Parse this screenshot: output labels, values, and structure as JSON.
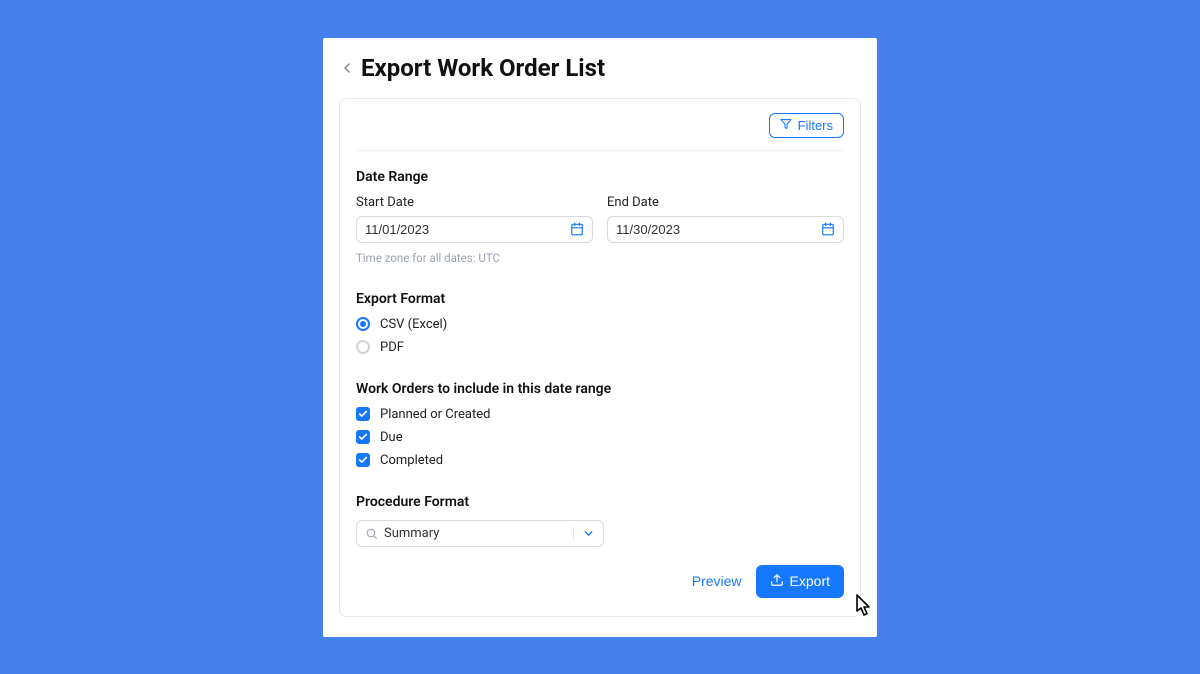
{
  "header": {
    "title": "Export Work Order List"
  },
  "filters": {
    "button_label": "Filters"
  },
  "date_range": {
    "section_title": "Date Range",
    "start_label": "Start Date",
    "start_value": "11/01/2023",
    "end_label": "End Date",
    "end_value": "11/30/2023",
    "timezone_note": "Time zone for all dates: UTC"
  },
  "export_format": {
    "section_title": "Export Format",
    "options": {
      "csv": "CSV (Excel)",
      "pdf": "PDF"
    },
    "selected": "csv"
  },
  "include": {
    "section_title": "Work Orders to include in this date range",
    "items": [
      "Planned or Created",
      "Due",
      "Completed"
    ]
  },
  "procedure_format": {
    "section_title": "Procedure Format",
    "value": "Summary"
  },
  "footer": {
    "preview_label": "Preview",
    "export_label": "Export"
  },
  "colors": {
    "primary": "#1677ff",
    "bg": "#4580ec"
  }
}
